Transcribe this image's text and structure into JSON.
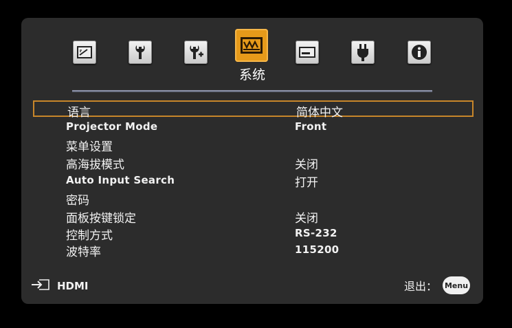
{
  "tabs": [
    {
      "name": "picture-tab",
      "icon": "picture-icon"
    },
    {
      "name": "display-tab",
      "icon": "wrench-icon"
    },
    {
      "name": "setup-tab",
      "icon": "wrench-plus-icon"
    },
    {
      "name": "system-tab",
      "icon": "system-icon",
      "active": true,
      "label": "系统"
    },
    {
      "name": "input-tab",
      "icon": "input-icon"
    },
    {
      "name": "power-tab",
      "icon": "plug-icon"
    },
    {
      "name": "info-tab",
      "icon": "info-icon"
    }
  ],
  "menu": [
    {
      "label": "语言",
      "value": "简体中文",
      "selected": true
    },
    {
      "label": "Projector Mode",
      "value": "Front"
    },
    {
      "label": "菜单设置",
      "value": ""
    },
    {
      "label": "高海拔模式",
      "value": "关闭"
    },
    {
      "label": "Auto Input Search",
      "value": "打开"
    },
    {
      "label": "密码",
      "value": ""
    },
    {
      "label": "面板按键锁定",
      "value": "关闭"
    },
    {
      "label": "控制方式",
      "value": "RS-232"
    },
    {
      "label": "波特率",
      "value": "115200"
    }
  ],
  "footer": {
    "source_icon": "input-source-icon",
    "source": "HDMI",
    "exit_label": "退出：",
    "menu_button": "Menu"
  },
  "colors": {
    "accent": "#e69a1a",
    "panel": "#2c2c2c",
    "selection_border": "#c8862a"
  }
}
